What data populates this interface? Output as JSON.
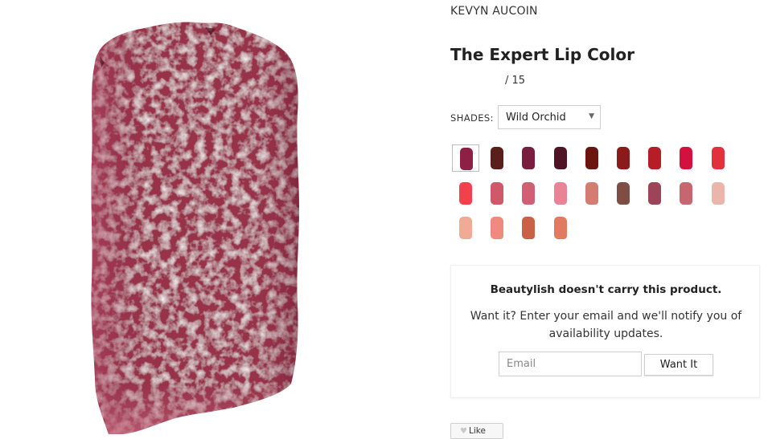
{
  "product": {
    "brand": "KEVYN AUCOIN",
    "title": "The Expert Lip Color",
    "rating_count": "/ 15"
  },
  "shades": {
    "label": "SHADES:",
    "selected": "Wild Orchid",
    "dropdown_icon": "caret-down-icon",
    "swatch_colors": [
      "#8e2045",
      "#5a1f1b",
      "#7a1e40",
      "#4f1426",
      "#6b1410",
      "#8c1a1a",
      "#b51e26",
      "#d2113e",
      "#e0313c",
      "#f2404d",
      "#cf5968",
      "#d15f73",
      "#e98497",
      "#d47b72",
      "#7e4d44",
      "#9e4458",
      "#c86670",
      "#eab6ac",
      "#f1ab94",
      "#ee8a7e",
      "#c96147",
      "#e07b61"
    ],
    "selected_index": 0
  },
  "notify": {
    "title": "Beautylish doesn't carry this product.",
    "description": "Want it? Enter your email and we'll notify you of availability updates.",
    "email_placeholder": "Email",
    "button_label": "Want It"
  },
  "like": {
    "label": "Like",
    "icon": "heart-icon"
  },
  "colors": {
    "swatch_primary": "#97304a",
    "text": "#222222",
    "border": "#cfcfcf"
  }
}
